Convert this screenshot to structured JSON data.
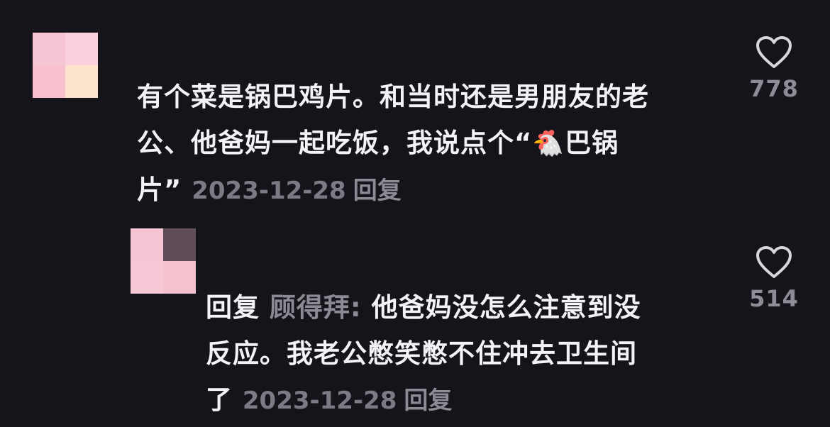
{
  "comments": [
    {
      "lines": [
        "有个菜是锅巴鸡片。和当时还是男朋友的老",
        "公、他爸妈一起吃饭，我说点个“"
      ],
      "emoji": "🐔",
      "after_emoji": "巴锅",
      "last_line": "片”",
      "date": "2023-12-28",
      "reply_label": "回复",
      "likes": "778",
      "like_icon": "heart-icon"
    },
    {
      "reply_prefix": "回复",
      "reply_target": "顾得拜:",
      "lines": [
        " 他爸妈没怎么注意到没",
        "反应。我老公憋笑憋不住冲去卫生间"
      ],
      "last_line": "了",
      "date": "2023-12-28",
      "reply_label": "回复",
      "likes": "514",
      "like_icon": "heart-icon"
    }
  ],
  "colors": {
    "background": "#16141b",
    "text": "#f4f4f6",
    "muted": "#7c7a82"
  }
}
